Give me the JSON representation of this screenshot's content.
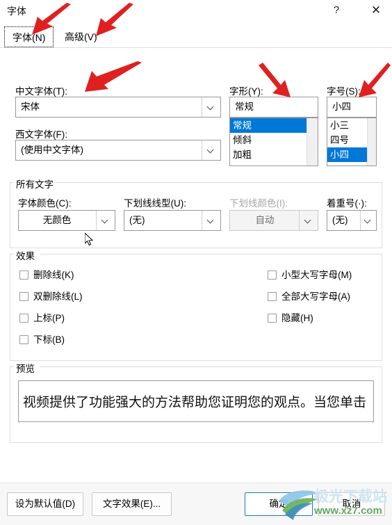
{
  "window": {
    "title": "字体",
    "help_label": "?",
    "close_label": "✕"
  },
  "tabs": [
    {
      "label": "字体(N)",
      "active": true
    },
    {
      "label": "高级(V)",
      "active": false
    }
  ],
  "font_section": {
    "chinese_font": {
      "label": "中文字体(T):",
      "value": "宋体"
    },
    "latin_font": {
      "label": "西文字体(F):",
      "value": "(使用中文字体)"
    },
    "font_style": {
      "label": "字形(Y):",
      "value": "常规",
      "options": [
        "常规",
        "倾斜",
        "加粗"
      ],
      "selected": "常规"
    },
    "font_size": {
      "label": "字号(S):",
      "value": "小四",
      "options": [
        "小三",
        "四号",
        "小四"
      ],
      "selected": "小四"
    }
  },
  "all_text_group": {
    "title": "所有文字",
    "font_color": {
      "label": "字体颜色(C):",
      "value": "无颜色",
      "disabled": false
    },
    "underline_style": {
      "label": "下划线线型(U):",
      "value": "(无)",
      "disabled": false
    },
    "underline_color": {
      "label": "下划线颜色(I):",
      "value": "自动",
      "disabled": true
    },
    "emphasis_mark": {
      "label": "着重号(·):",
      "value": "(无)",
      "disabled": false
    }
  },
  "effects_group": {
    "title": "效果",
    "left_column": [
      {
        "label": "删除线(K)",
        "checked": false
      },
      {
        "label": "双删除线(L)",
        "checked": false
      },
      {
        "label": "上标(P)",
        "checked": false
      },
      {
        "label": "下标(B)",
        "checked": false
      }
    ],
    "right_column": [
      {
        "label": "小型大写字母(M)",
        "checked": false
      },
      {
        "label": "全部大写字母(A)",
        "checked": false
      },
      {
        "label": "隐藏(H)",
        "checked": false
      }
    ]
  },
  "preview_group": {
    "title": "预览",
    "text": "视频提供了功能强大的方法帮助您证明您的观点。当您单击"
  },
  "footer": {
    "set_default_label": "设为默认值(D)",
    "text_effects_label": "文字效果(E)...",
    "ok_label": "确定",
    "cancel_label": "取消"
  },
  "watermark": {
    "brand": "极光下载站",
    "url": "www.xz7.com"
  },
  "colors": {
    "selection_blue": "#0078d7",
    "default_button_border": "#1a77c4",
    "annotation_red": "#e02020",
    "disabled_text": "#a6a6a6"
  }
}
